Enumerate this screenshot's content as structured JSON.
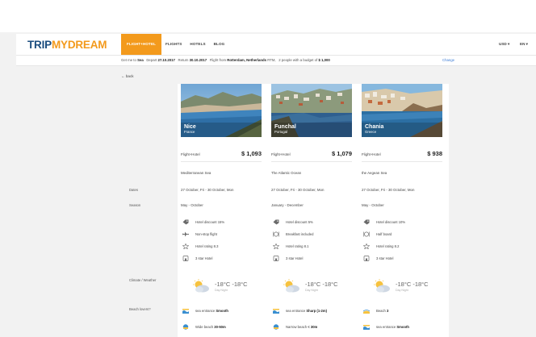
{
  "brand": {
    "trip": "TRIP",
    "my": "MY",
    "dream": "DREAM"
  },
  "nav": {
    "flight_hotel": "FLIGHT+HOTEL",
    "flights": "FLIGHTS",
    "hotels": "HOTELS",
    "blog": "BLOG"
  },
  "settings": {
    "currency": "USD ▾",
    "language": "EN ▾"
  },
  "info": {
    "prefix": "Get me to",
    "dest": "Sea",
    "depart_label": "Depart",
    "depart": "27.10.2017",
    "return_label": "Return",
    "return": "30.10.2017",
    "flight_from_label": "Flight from",
    "flight_from": "Rotterdam, Netherlands",
    "airport": "RTM,",
    "people": "2 people with a budget of",
    "budget": "$ 1,000",
    "change": "Change"
  },
  "back": "← back",
  "row_labels": {
    "dates": "Dates",
    "season": "Season",
    "climate": "Climate / Weather",
    "beach": "Beach lovers?"
  },
  "flight_hotel_label": "Flight+Hotel",
  "destinations": [
    {
      "city": "Nice",
      "country": "France",
      "price": "$ 1,093",
      "sea": "Mediterranean Sea",
      "dates": "27 October, Fri - 30 October, Mon",
      "season": "May - October",
      "features": [
        "Hotel discount 15%",
        "Non-stop flight",
        "Hotel rating 8.3",
        "3 star Hotel"
      ],
      "temp": "-18°C -18°C",
      "temp_sub": "Day          Night",
      "beach": [
        {
          "label": "sea entrance",
          "value": "Smooth"
        },
        {
          "label": "Wide beach",
          "value": "30-50m"
        }
      ]
    },
    {
      "city": "Funchal",
      "country": "Portugal",
      "price": "$ 1,079",
      "sea": "The Atlantic Ocean",
      "dates": "27 October, Fri - 30 October, Mon",
      "season": "January - December",
      "features": [
        "Hotel discount 5%",
        "Breakfast included",
        "Hotel rating 8.1",
        "3 star Hotel"
      ],
      "temp": "-18°C -18°C",
      "temp_sub": "Day          Night",
      "beach": [
        {
          "label": "sea entrance",
          "value": "Sharp (1-2m)"
        },
        {
          "label": "Narrow beach",
          "value": "< 30m"
        }
      ]
    },
    {
      "city": "Chania",
      "country": "Greece",
      "price": "$ 938",
      "sea": "the Aegean Sea",
      "dates": "27 October, Fri - 30 October, Mon",
      "season": "May - October",
      "features": [
        "Hotel discount 10%",
        "Half board",
        "Hotel rating 8.2",
        "3 star Hotel"
      ],
      "temp": "-18°C -18°C",
      "temp_sub": "Day          Night",
      "beach": [
        {
          "label": "Beach",
          "value": "3"
        },
        {
          "label": "sea entrance",
          "value": "Smooth"
        }
      ]
    }
  ],
  "colors": {
    "accent": "#f39a1c",
    "brand_blue": "#1c4e80",
    "link": "#3a7bd5"
  }
}
